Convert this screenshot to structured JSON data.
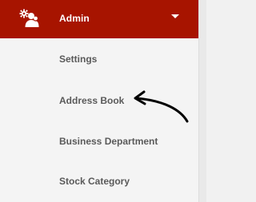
{
  "menu": {
    "title": "Admin",
    "icon": "users-gear-icon",
    "items": [
      {
        "label": "Settings"
      },
      {
        "label": "Address Book"
      },
      {
        "label": "Business Department"
      },
      {
        "label": "Stock Category"
      }
    ]
  },
  "colors": {
    "header_bg": "#a71400",
    "header_text": "#ffffff",
    "item_text": "#5a5a5a",
    "panel_bg": "#f4f4f4"
  }
}
